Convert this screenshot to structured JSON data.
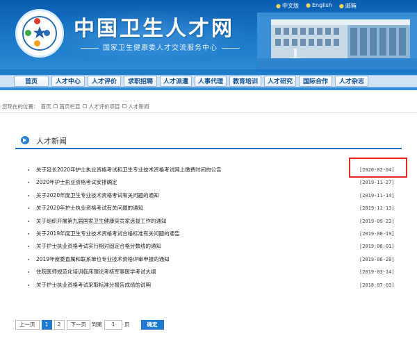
{
  "header": {
    "title": "中国卫生人才网",
    "subtitle": "国家卫生健康委人才交流服务中心",
    "links": [
      "中文版",
      "English",
      "邮箱"
    ],
    "colors": {
      "primary": "#1a78c8",
      "accent": "#e5251f",
      "nav_text": "#0d4f93"
    }
  },
  "nav": {
    "items": [
      "首页",
      "人才中心",
      "人才评价",
      "求职招聘",
      "人才派遣",
      "人事代理",
      "教育培训",
      "人才研究",
      "国际合作",
      "人才杂志"
    ]
  },
  "breadcrumb": {
    "label": "您现在的位置：",
    "items": [
      "首页",
      "首页栏目",
      "人才评价项目",
      "人才新闻"
    ]
  },
  "section": {
    "title": "人才新闻"
  },
  "news": [
    {
      "title": "关于延长2020年护士执业资格考试和卫生专业技术资格考试网上缴费时间的公告",
      "date": "[2020-02-04]"
    },
    {
      "title": "2020年护士执业资格考试安排确定",
      "date": "[2019-11-27]"
    },
    {
      "title": "关于2020年度卫生专业技术资格考试有关问题的通知",
      "date": "[2019-11-14]"
    },
    {
      "title": "关于2020年护士执业资格考试有关问题的通知",
      "date": "[2019-11-13]"
    },
    {
      "title": "关于组织开展第九届国家卫生健康突贡家选拔工作的通知",
      "date": "[2019-09-23]"
    },
    {
      "title": "关于2019年度卫生专业技术资格考试合格标准有关问题的通告",
      "date": "[2019-08-19]"
    },
    {
      "title": "关于护士执业资格考试实行相对固定合格分数线的通知",
      "date": "[2019-08-01]"
    },
    {
      "title": "2019年度委直属和联系单位专业技术资格评审申报的通知",
      "date": "[2019-06-28]"
    },
    {
      "title": "住院医师规范化培训临床理论考核军事医学考试大纲",
      "date": "[2019-03-14]"
    },
    {
      "title": "关于护士执业资格考试采取标准分报告成绩的说明",
      "date": "[2018-07-03]"
    }
  ],
  "pager": {
    "prev": "上一页",
    "pages": [
      "1",
      "2"
    ],
    "current": "1",
    "next": "下一页",
    "goto_prefix": "到第",
    "goto_value": "1",
    "goto_suffix": "页",
    "confirm": "确定"
  }
}
